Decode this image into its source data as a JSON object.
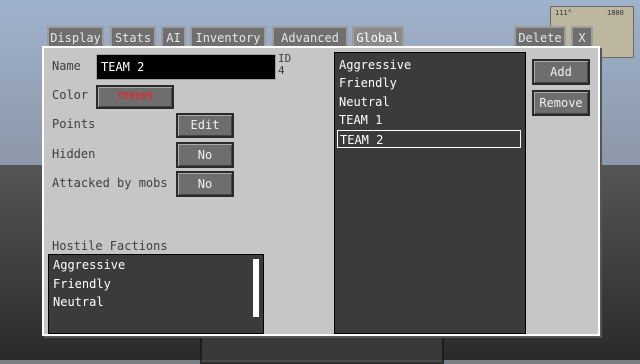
{
  "tabs": [
    "Display",
    "Stats",
    "AI",
    "Inventory",
    "Advanced",
    "Global"
  ],
  "delete_label": "Delete",
  "close_label": "X",
  "name_label": "Name",
  "name_value": "TEAM 2",
  "id_label": "ID",
  "id_value": "4",
  "color_label": "Color",
  "color_value": "f00b09",
  "points_label": "Points",
  "points_button": "Edit",
  "hidden_label": "Hidden",
  "hidden_value": "No",
  "attacked_label": "Attacked by mobs",
  "attacked_value": "No",
  "hostile_label": "Hostile Factions",
  "hostile_list": [
    "Aggressive",
    "Friendly",
    "Neutral"
  ],
  "faction_list": [
    "Aggressive",
    "Friendly",
    "Neutral",
    "TEAM 1",
    "TEAM 2"
  ],
  "selected_faction": "TEAM 2",
  "add_label": "Add",
  "remove_label": "Remove",
  "map": {
    "left": "111°",
    "right": "1800"
  },
  "colors": {
    "accent_text": "#ff1a1a",
    "panel": "#c6c6c6",
    "list_bg": "#3b3b3b"
  }
}
